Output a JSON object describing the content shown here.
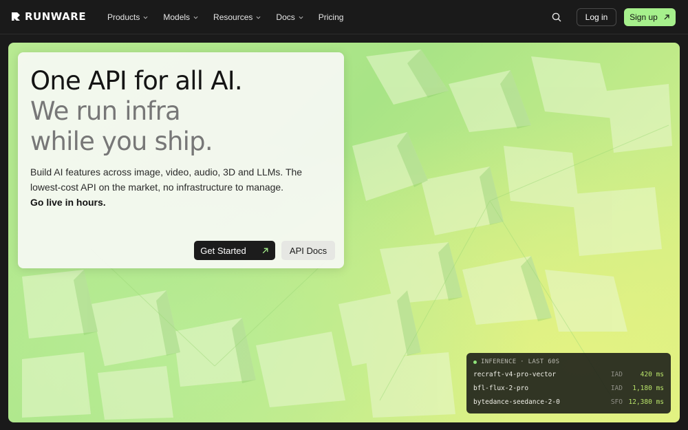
{
  "brand": {
    "name": "RUNWARE",
    "accent": "#a6f08c"
  },
  "nav": {
    "items": [
      {
        "label": "Products",
        "has_dropdown": true
      },
      {
        "label": "Models",
        "has_dropdown": true
      },
      {
        "label": "Resources",
        "has_dropdown": true
      },
      {
        "label": "Docs",
        "has_dropdown": true
      },
      {
        "label": "Pricing",
        "has_dropdown": false
      }
    ],
    "search_icon": "search-icon",
    "login_label": "Log in",
    "signup_label": "Sign up"
  },
  "hero": {
    "headline_1": "One API for all AI.",
    "headline_2": "We run infra",
    "headline_3": "while you ship.",
    "description": "Build AI features across image, video, audio, 3D and LLMs. The lowest-cost API on the market, no infrastructure to manage.",
    "description_bold": "Go live in hours.",
    "primary_cta": "Get Started",
    "secondary_cta": "API Docs"
  },
  "inference": {
    "header": "INFERENCE · LAST 60S",
    "status_color": "#8fe27a",
    "rows": [
      {
        "model": "recraft-v4-pro-vector",
        "region": "IAD",
        "latency": "420 ms"
      },
      {
        "model": "bfl-flux-2-pro",
        "region": "IAD",
        "latency": "1,180 ms"
      },
      {
        "model": "bytedance-seedance-2-0",
        "region": "SFO",
        "latency": "12,380 ms"
      }
    ]
  }
}
